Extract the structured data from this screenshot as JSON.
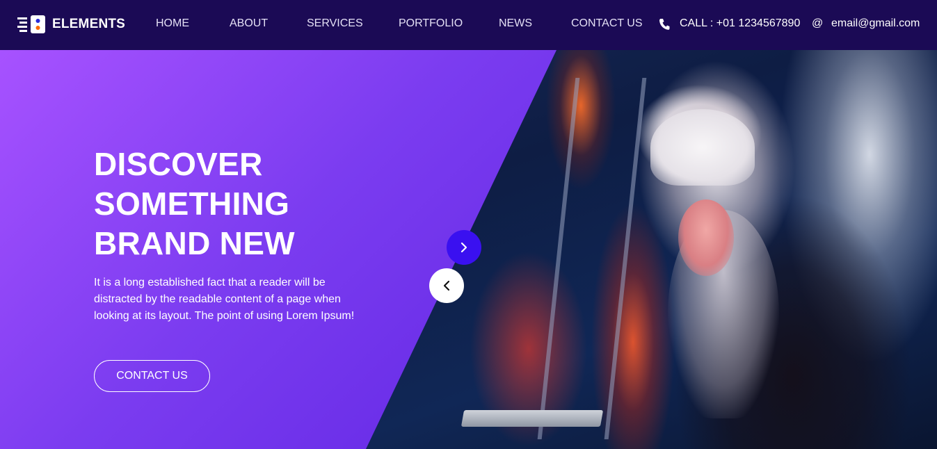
{
  "brand": {
    "name": "ELEMENTS",
    "colors": {
      "nav_bg": "#1b0a55",
      "accent": "#3a10f0",
      "hero_gradient_start": "#a752ff",
      "hero_gradient_end": "#5a22df"
    }
  },
  "nav": {
    "items": [
      {
        "label": "HOME"
      },
      {
        "label": "ABOUT"
      },
      {
        "label": "SERVICES"
      },
      {
        "label": "PORTFOLIO"
      },
      {
        "label": "NEWS"
      },
      {
        "label": "CONTACT US"
      }
    ]
  },
  "contact": {
    "phone_icon": "phone-icon",
    "phone": "CALL : +01 1234567890",
    "email_icon_glyph": "@",
    "email": "email@gmail.com"
  },
  "hero": {
    "headline": [
      "DISCOVER",
      "SOMETHING",
      "BRAND NEW"
    ],
    "description": "It is a long established fact that a reader will be distracted by the readable content of a page when looking at its layout. The point of using Lorem Ipsum!",
    "cta_label": "CONTACT US",
    "slider": {
      "next_icon": "chevron-right-icon",
      "prev_icon": "chevron-left-icon"
    }
  }
}
